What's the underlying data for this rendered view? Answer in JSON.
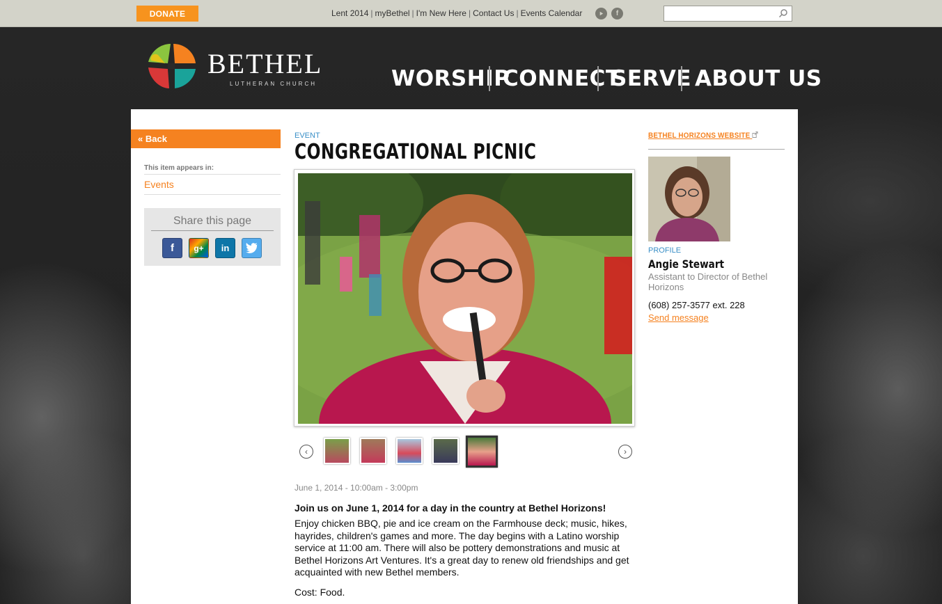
{
  "topbar": {
    "donate_label": "DONATE",
    "links": [
      "Lent 2014",
      "myBethel",
      "I'm New Here",
      "Contact Us",
      "Events Calendar"
    ],
    "search_placeholder": ""
  },
  "header": {
    "logo_name": "BETHEL",
    "logo_sub": "LUTHERAN CHURCH",
    "nav": [
      "WORSHIP",
      "CONNECT",
      "SERVE",
      "ABOUT US"
    ]
  },
  "sidebar": {
    "back_label": "« Back",
    "appears_label": "This item appears in:",
    "events_link": "Events",
    "share_title": "Share this page"
  },
  "event": {
    "type_label": "EVENT",
    "title": "CONGREGATIONAL PICNIC",
    "date": "June 1, 2014 - 10:00am - 3:00pm",
    "lead": "Join us on June 1, 2014 for a day in the country at Bethel Horizons!",
    "body": "Enjoy chicken BBQ, pie and ice cream on the Farmhouse deck; music, hikes, hayrides, children's games and more. The day begins with a Latino worship service at 11:00 am. There will also be pottery demonstrations and music at Bethel Horizons Art Ventures. It's a great day to renew old friendships and get acquainted with new Bethel members.",
    "cost": "Cost: Food."
  },
  "profile": {
    "website_link": "BETHEL HORIZONS WEBSITE",
    "label": "PROFILE",
    "name": "Angie Stewart",
    "role": "Assistant to Director of Bethel Horizons",
    "phone": "(608) 257-3577 ext. 228",
    "send_message": "Send message"
  },
  "colors": {
    "accent": "#f58220",
    "link_blue": "#3a8fc7"
  }
}
